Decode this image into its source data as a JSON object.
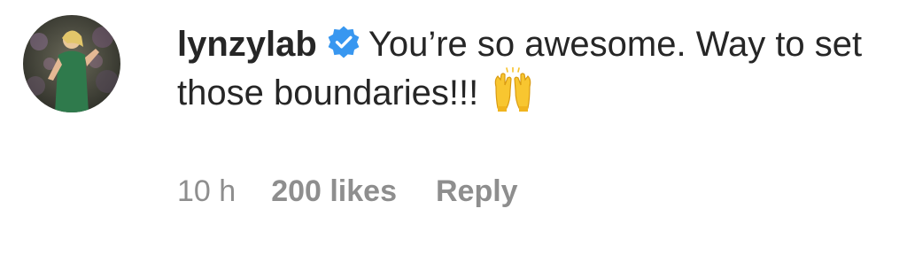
{
  "comment": {
    "avatar_icon": "profile-photo",
    "username": "lynzylab",
    "verified_icon": "verified-badge-icon",
    "text": "You’re so awesome. Way to set those boundaries!!!",
    "emoji_icon": "raising-hands-emoji",
    "timestamp": "10 h",
    "likes": "200 likes",
    "reply_label": "Reply"
  },
  "colors": {
    "text": "#262626",
    "muted": "#8e8e8e",
    "verified": "#3897f0"
  }
}
